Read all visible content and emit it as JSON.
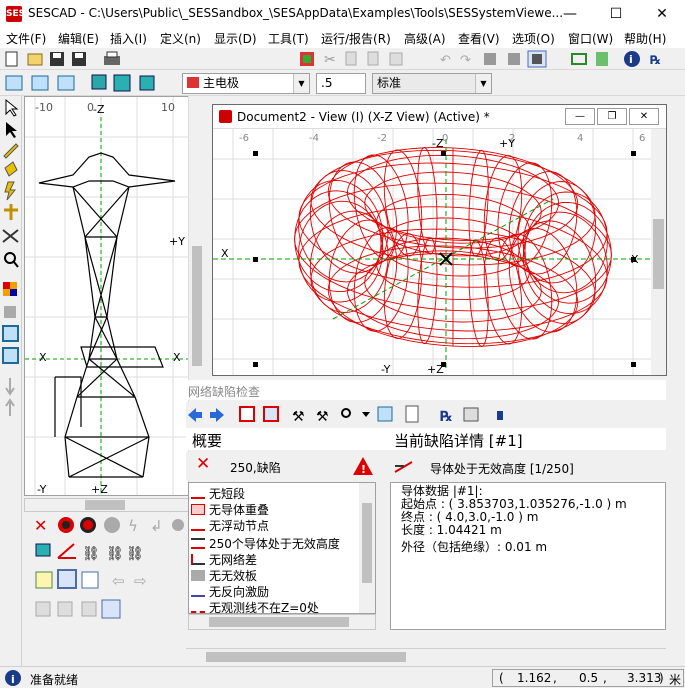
{
  "window": {
    "title": "SESCAD - C:\\Users\\Public\\_SESSandbox_\\SESAppData\\Examples\\Tools\\SESSystemViewe...",
    "app_icon_text": "SES",
    "minimize": "—",
    "maximize": "☐",
    "close": "✕"
  },
  "menu": [
    "文件(F)",
    "编辑(E)",
    "插入(I)",
    "定义(n)",
    "显示(D)",
    "工具(T)",
    "运行/报告(R)",
    "高级(A)",
    "查看(V)",
    "选项(O)",
    "窗口(W)",
    "帮助(H)"
  ],
  "toolbar": {
    "layer_select": "主电极",
    "value_input": ".5",
    "style_select": "标准"
  },
  "left_view": {
    "axis_top": "-Z",
    "axis_right": "+Y",
    "axis_left": "X",
    "axis_right2": "X",
    "axis_bottom_left": "-Y",
    "axis_bottom": "+Z",
    "ruler_top": [
      "-10",
      "0",
      "10"
    ]
  },
  "document": {
    "title": "Document2 - View (I) (X-Z View) (Active) *",
    "axis_top": "-Z",
    "axis_top_right": "+Y",
    "axis_left": "X",
    "axis_right": "X",
    "axis_bottom": "+Z",
    "axis_bottom_left": "-Y",
    "ruler": [
      "-6",
      "-4",
      "-2",
      "0",
      "2",
      "4",
      "6"
    ]
  },
  "panel": {
    "caption": "网络缺陷检查",
    "overview_title": "概要",
    "error_count": "250,缺陷",
    "detail_title": "当前缺陷详情 [#1]",
    "detail_header": "导体处于无效高度 [1/250]",
    "list_items": [
      "无短段",
      "无导体重叠",
      "无浮动节点",
      "250个导体处于无效高度",
      "无网络差",
      "无无效板",
      "无反向激励",
      "无观测线不在Z=0处"
    ],
    "detail_lines": [
      "导体数据      |#1|:",
      "起始点  : ( 3.853703,1.035276,-1.0 ) m",
      "终点     : ( 4.0,3.0,-1.0 ) m",
      "长度      : 1.04421 m",
      "外径（包括绝缘）: 0.01 m"
    ]
  },
  "status": {
    "text": "准备就绪",
    "x": "1.162",
    "y": "0.5",
    "z": "3.313",
    "unit": "米"
  },
  "colors": {
    "wire_red": "#e00000",
    "axis_green": "#00a000",
    "select_blue": "#0078d7"
  }
}
